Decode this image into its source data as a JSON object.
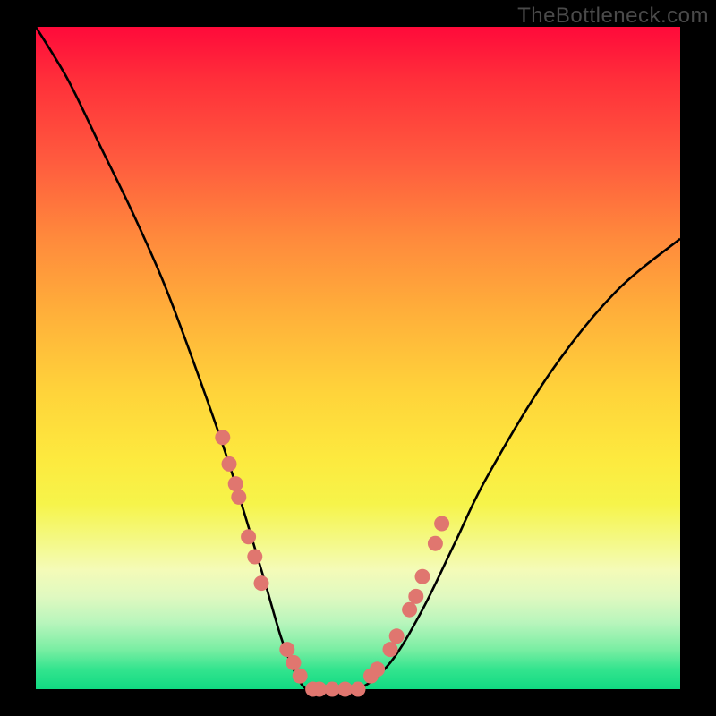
{
  "watermark": "TheBottleneck.com",
  "chart_data": {
    "type": "line",
    "title": "",
    "xlabel": "",
    "ylabel": "",
    "xlim": [
      0,
      100
    ],
    "ylim": [
      0,
      100
    ],
    "series": [
      {
        "name": "bottleneck-curve",
        "x": [
          0,
          5,
          10,
          15,
          20,
          25,
          30,
          35,
          38,
          40,
          42,
          45,
          50,
          55,
          60,
          65,
          70,
          80,
          90,
          100
        ],
        "y": [
          100,
          92,
          82,
          72,
          61,
          48,
          34,
          18,
          8,
          3,
          0,
          0,
          0,
          4,
          12,
          22,
          32,
          48,
          60,
          68
        ]
      }
    ],
    "highlight_points": {
      "name": "sample-dots",
      "x": [
        29,
        30,
        31,
        31.5,
        33,
        34,
        35,
        39,
        40,
        41,
        43,
        44,
        46,
        48,
        50,
        52,
        53,
        55,
        56,
        58,
        59,
        60,
        62,
        63
      ],
      "y": [
        38,
        34,
        31,
        29,
        23,
        20,
        16,
        6,
        4,
        2,
        0,
        0,
        0,
        0,
        0,
        2,
        3,
        6,
        8,
        12,
        14,
        17,
        22,
        25
      ]
    },
    "dot_color": "#e0766f",
    "curve_color": "#000000",
    "gradient_stops": [
      {
        "pos": 0.0,
        "color": "#ff0a3a"
      },
      {
        "pos": 0.5,
        "color": "#ffd33a"
      },
      {
        "pos": 0.8,
        "color": "#f4f98a"
      },
      {
        "pos": 1.0,
        "color": "#11da82"
      }
    ]
  }
}
